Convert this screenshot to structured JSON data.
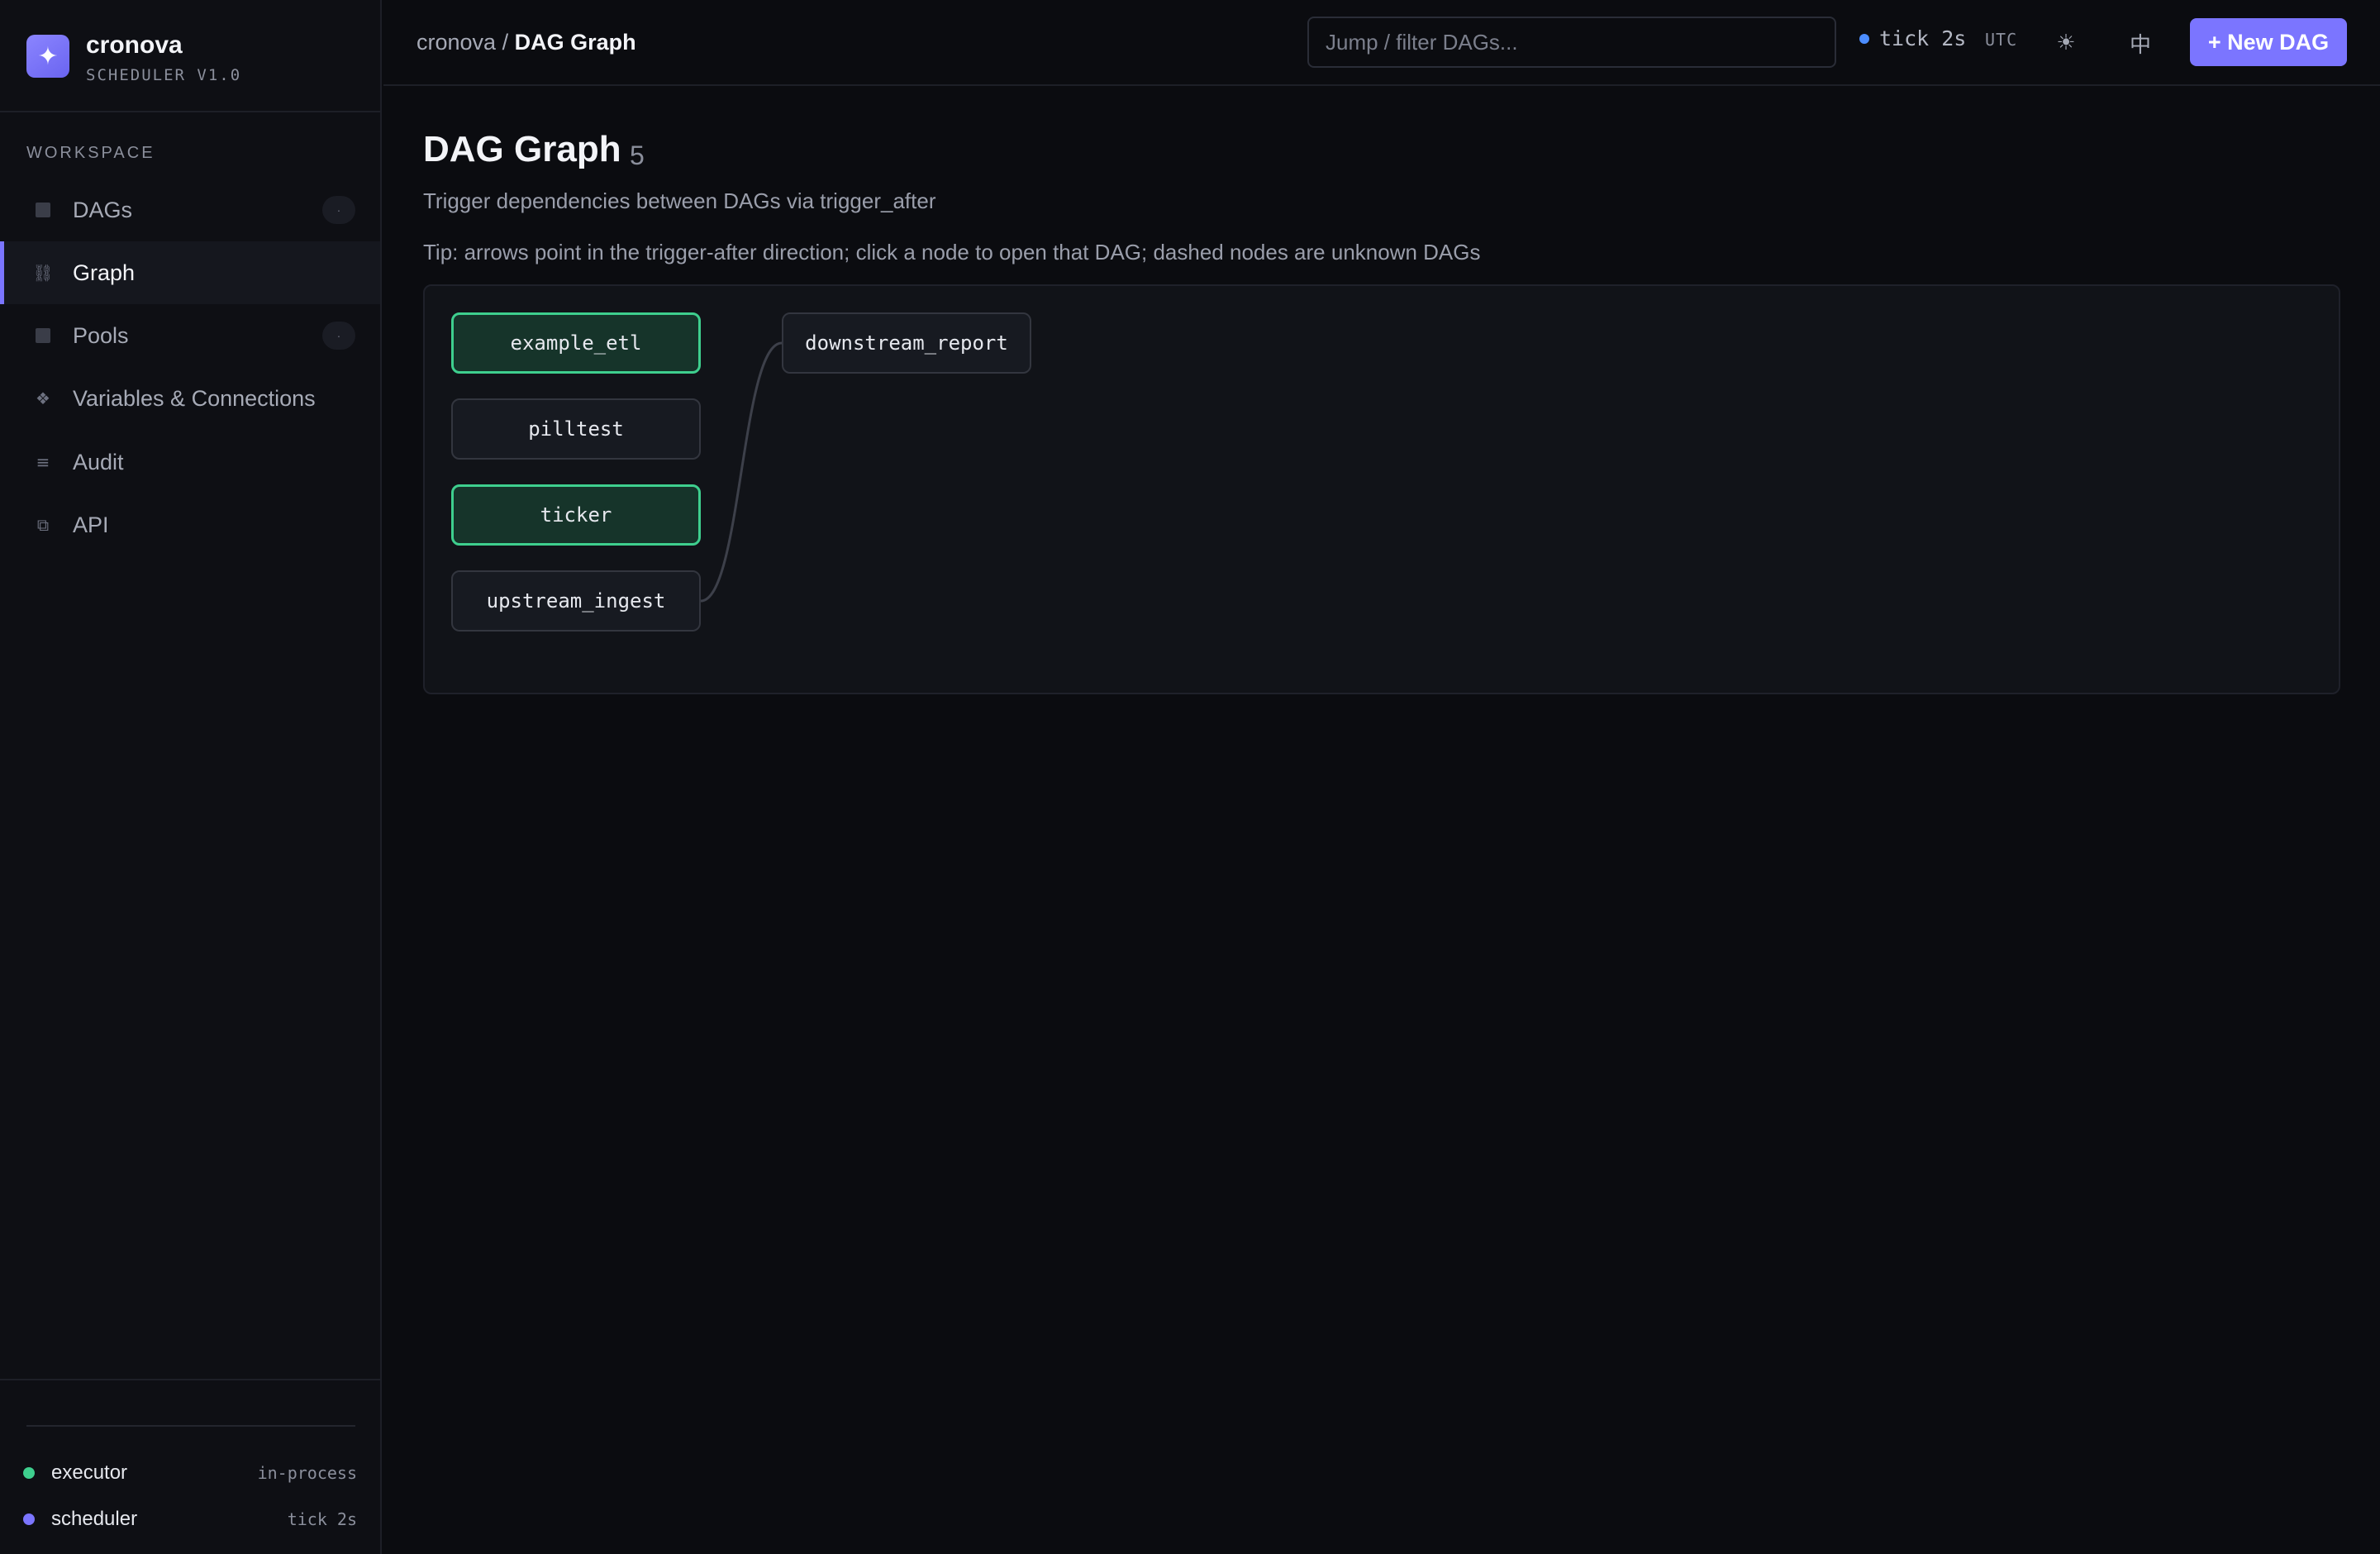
{
  "brand": {
    "logo": "✦",
    "name": "cronova",
    "subtitle": "SCHEDULER V1.0"
  },
  "sidebar": {
    "section": "WORKSPACE",
    "items": [
      {
        "label": "DAGs",
        "icon": "square-icon",
        "badge": "·",
        "active": false
      },
      {
        "label": "Graph",
        "icon": "link-icon",
        "glyph": "⛓",
        "active": true
      },
      {
        "label": "Pools",
        "icon": "square-icon",
        "badge": "·",
        "active": false
      },
      {
        "label": "Variables & Connections",
        "icon": "diamond-icon",
        "glyph": "❖",
        "active": false
      },
      {
        "label": "Audit",
        "icon": "list-icon",
        "glyph": "≡",
        "active": false
      },
      {
        "label": "API",
        "icon": "copy-icon",
        "glyph": "⧉",
        "active": false
      }
    ],
    "status": [
      {
        "name": "executor",
        "value": "in-process",
        "color": "#3ecf8e"
      },
      {
        "name": "scheduler",
        "value": "tick 2s",
        "color": "#7b75ff"
      }
    ]
  },
  "topbar": {
    "breadcrumb_root": "cronova",
    "breadcrumb_sep": " / ",
    "breadcrumb_current": "DAG Graph",
    "search_placeholder": "Jump / filter DAGs...",
    "tick": "tick 2s",
    "timezone": "UTC",
    "theme_icon": "☀",
    "lang_icon": "中",
    "new_button": "+ New DAG"
  },
  "page": {
    "title": "DAG Graph",
    "count": "5",
    "subtitle": "Trigger dependencies between DAGs via trigger_after",
    "tip": "Tip: arrows point in the trigger-after direction; click a node to open that DAG; dashed nodes are unknown DAGs"
  },
  "graph": {
    "nodes": [
      {
        "id": "example_etl",
        "label": "example_etl",
        "active": true
      },
      {
        "id": "pilltest",
        "label": "pilltest",
        "active": false
      },
      {
        "id": "ticker",
        "label": "ticker",
        "active": true
      },
      {
        "id": "upstream_ingest",
        "label": "upstream_ingest",
        "active": false
      },
      {
        "id": "downstream_report",
        "label": "downstream_report",
        "active": false
      }
    ],
    "edges": [
      {
        "from": "upstream_ingest",
        "to": "downstream_report"
      }
    ]
  },
  "colors": {
    "accent": "#7b75ff",
    "success": "#3ecf8e",
    "info": "#4c8dff"
  }
}
